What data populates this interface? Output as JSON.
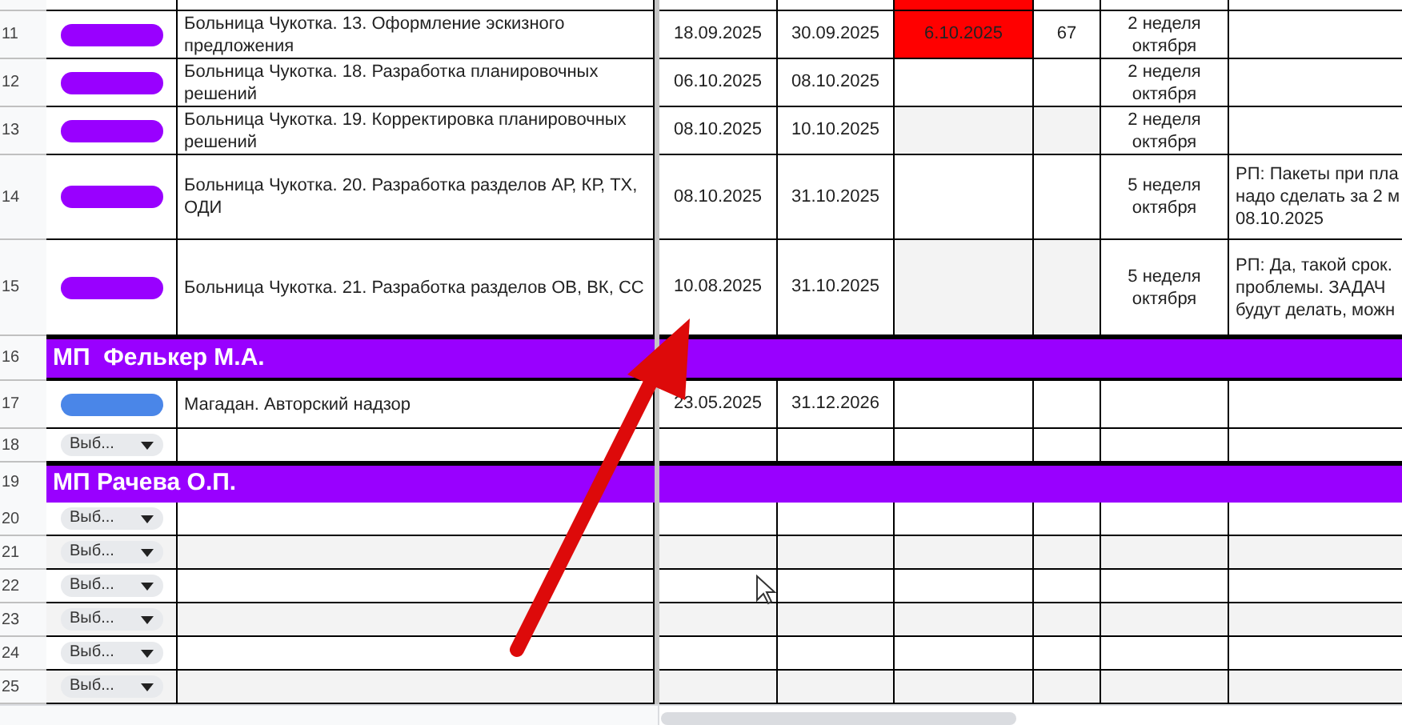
{
  "rows": [
    {
      "kind": "task",
      "number": "11",
      "status": {
        "kind": "pill",
        "color": "#9900ff"
      },
      "name": "Больница Чукотка. 13. Оформление эскизного предложения",
      "start": "18.09.2025",
      "end": "30.09.2025",
      "fact": {
        "text": "6.10.2025",
        "kind": "alert"
      },
      "days": {
        "text": "67",
        "kind": "plain"
      },
      "week": "2 неделя октября",
      "comment_lines": []
    },
    {
      "kind": "task",
      "number": "12",
      "status": {
        "kind": "pill",
        "color": "#9900ff"
      },
      "name": "Больница Чукотка. 18. Разработка планировочных решений",
      "start": "06.10.2025",
      "end": "08.10.2025",
      "fact": {
        "kind": "plain"
      },
      "days": {
        "kind": "plain"
      },
      "week": "2 неделя октября",
      "comment_lines": []
    },
    {
      "kind": "task",
      "number": "13",
      "status": {
        "kind": "pill",
        "color": "#9900ff"
      },
      "name": "Больница Чукотка. 19. Корректировка планировочных решений",
      "start": "08.10.2025",
      "end": "10.10.2025",
      "fact": {
        "kind": "muted"
      },
      "days": {
        "kind": "muted"
      },
      "week": "2 неделя октября",
      "comment_lines": []
    },
    {
      "kind": "task",
      "number": "14",
      "status": {
        "kind": "pill",
        "color": "#9900ff"
      },
      "name": "Больница Чукотка. 20. Разработка разделов АР, КР, ТХ, ОДИ",
      "start": "08.10.2025",
      "end": "31.10.2025",
      "fact": {
        "kind": "plain"
      },
      "days": {
        "kind": "plain"
      },
      "week": "5 неделя октября",
      "comment_lines": [
        "РП: Пакеты при пла",
        "надо сделать за 2 м",
        "08.10.2025"
      ]
    },
    {
      "kind": "task",
      "number": "15",
      "status": {
        "kind": "pill",
        "color": "#9900ff"
      },
      "name": "Больница Чукотка. 21. Разработка разделов ОВ, ВК, СС",
      "start": "10.08.2025",
      "end": "31.10.2025",
      "fact": {
        "kind": "muted"
      },
      "days": {
        "kind": "muted"
      },
      "week": "5 неделя октября",
      "comment_lines": [
        "РП: Да, такой срок.",
        "проблемы. ЗАДАЧ",
        "будут делать, можн"
      ]
    },
    {
      "kind": "group",
      "number": "16",
      "title": "МП  Фелькер М.А."
    },
    {
      "kind": "task",
      "number": "17",
      "status": {
        "kind": "pill",
        "color": "#4a86e8"
      },
      "name": "Магадан. Авторский надзор",
      "start": "23.05.2025",
      "end": "31.12.2026",
      "fact": {
        "kind": "plain"
      },
      "days": {
        "kind": "plain"
      },
      "comment_lines": []
    },
    {
      "kind": "task",
      "number": "18",
      "status": {
        "kind": "dropdown",
        "label": "Выб..."
      },
      "fact": {
        "kind": "plain"
      },
      "days": {
        "kind": "plain"
      },
      "comment_lines": []
    },
    {
      "kind": "group",
      "number": "19",
      "title": "МП Рачева О.П."
    },
    {
      "kind": "empty",
      "number": "20",
      "shaded": false,
      "status": {
        "kind": "dropdown",
        "label": "Выб..."
      }
    },
    {
      "kind": "empty",
      "number": "21",
      "shaded": true,
      "status": {
        "kind": "dropdown",
        "label": "Выб..."
      }
    },
    {
      "kind": "empty",
      "number": "22",
      "shaded": false,
      "status": {
        "kind": "dropdown",
        "label": "Выб..."
      }
    },
    {
      "kind": "empty",
      "number": "23",
      "shaded": true,
      "status": {
        "kind": "dropdown",
        "label": "Выб..."
      }
    },
    {
      "kind": "empty",
      "number": "24",
      "shaded": false,
      "status": {
        "kind": "dropdown",
        "label": "Выб..."
      }
    },
    {
      "kind": "empty",
      "number": "25",
      "shaded": true,
      "status": {
        "kind": "dropdown",
        "label": "Выб..."
      }
    }
  ]
}
